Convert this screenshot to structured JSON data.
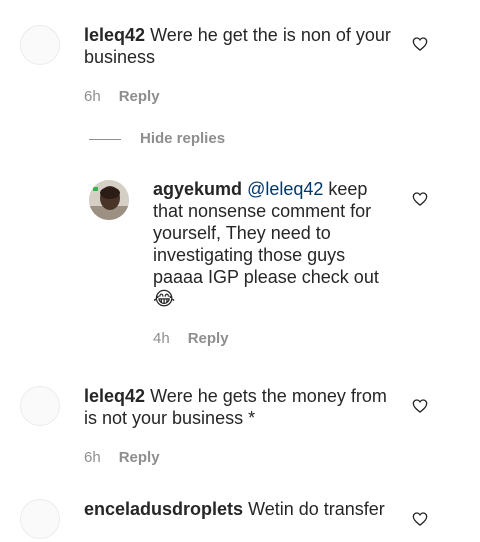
{
  "comments": [
    {
      "username": "leleq42",
      "text": "Were he get the is non of your business",
      "time": "6h",
      "reply_label": "Reply"
    },
    {
      "username": "leleq42",
      "text": "Were he gets the money from is not your business *",
      "time": "6h",
      "reply_label": "Reply"
    },
    {
      "username": "enceladusdroplets",
      "text": "Wetin do transfer"
    }
  ],
  "hide_replies_label": "Hide replies",
  "reply": {
    "username": "agyekumd",
    "mention": "@leleq42",
    "text": "keep that nonsense comment for yourself, They need to investigating those guys paaaa IGP please check out",
    "emoji": "😂",
    "time": "4h",
    "reply_label": "Reply"
  },
  "icons": {
    "like": "heart-outline-icon"
  },
  "colors": {
    "text": "#262626",
    "secondary": "#8e8e8e",
    "mention": "#00376b"
  }
}
